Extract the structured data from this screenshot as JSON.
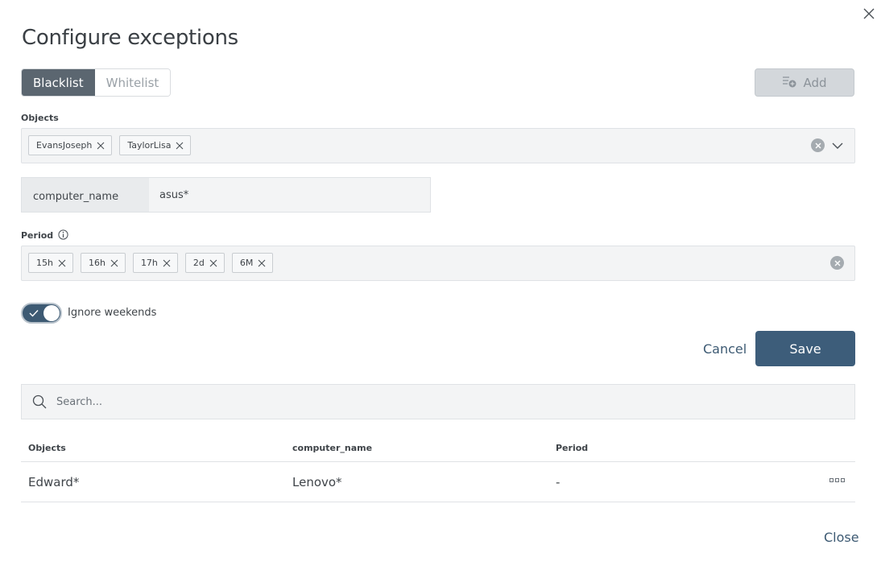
{
  "dialog": {
    "title": "Configure exceptions",
    "close_icon": "close-icon"
  },
  "list_type": {
    "options": [
      "Blacklist",
      "Whitelist"
    ],
    "selected": "Blacklist"
  },
  "add_button": {
    "label": "Add",
    "icon": "add-list-icon",
    "disabled": true
  },
  "objects": {
    "label": "Objects",
    "chips": [
      "EvansJoseph",
      "TaylorLisa"
    ]
  },
  "attribute": {
    "key": "computer_name",
    "value": "asus*"
  },
  "period": {
    "label": "Period",
    "chips": [
      "15h",
      "16h",
      "17h",
      "2d",
      "6M"
    ]
  },
  "ignore_weekends": {
    "label": "Ignore weekends",
    "enabled": true
  },
  "actions": {
    "cancel": "Cancel",
    "save": "Save"
  },
  "search": {
    "placeholder": "Search..."
  },
  "table": {
    "columns": [
      "Objects",
      "computer_name",
      "Period"
    ],
    "rows": [
      {
        "objects": "Edward*",
        "computer_name": "Lenovo*",
        "period": "-"
      }
    ]
  },
  "footer": {
    "close": "Close"
  },
  "colors": {
    "accent": "#3d5d7a",
    "segment_active": "#5b6670"
  }
}
